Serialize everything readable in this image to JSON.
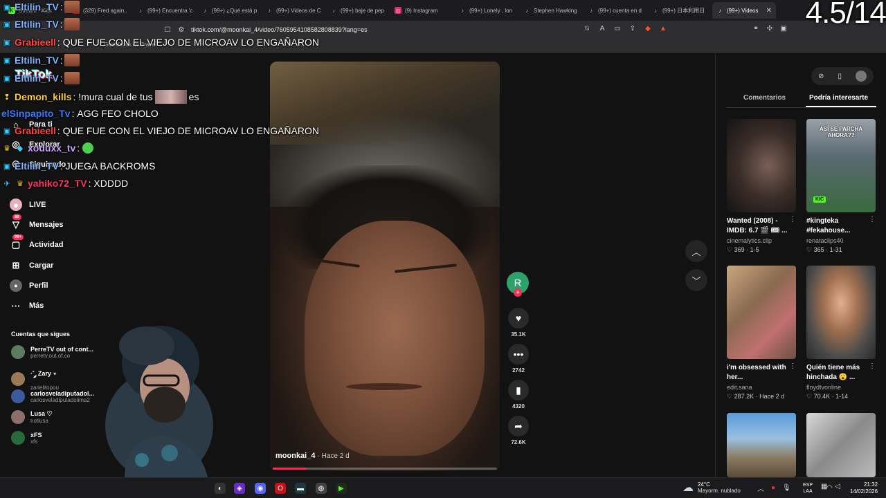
{
  "browser": {
    "tabs": [
      {
        "label": "Stream - Kick",
        "icon": "kick-icon",
        "color": "#53fc18"
      },
      {
        "label": "(329) Fred again..",
        "icon": "youtube-icon",
        "color": "#ff0000"
      },
      {
        "label": "(99+) Encuentra 'c",
        "icon": "tiktok-icon",
        "color": "#ffffff"
      },
      {
        "label": "(99+) ¿Qué está p",
        "icon": "tiktok-icon",
        "color": "#ffffff"
      },
      {
        "label": "(99+) Videos de C",
        "icon": "tiktok-icon",
        "color": "#ffffff"
      },
      {
        "label": "(99+) baje de pep",
        "icon": "tiktok-icon",
        "color": "#ffffff"
      },
      {
        "label": "(9) Instagram",
        "icon": "instagram-icon",
        "color": "#e1306c"
      },
      {
        "label": "(99+) Lonely , lon",
        "icon": "tiktok-icon",
        "color": "#ffffff"
      },
      {
        "label": "Stephen Hawking",
        "icon": "tiktok-icon",
        "color": "#ffffff"
      },
      {
        "label": "(99+) cuenta en d",
        "icon": "tiktok-icon",
        "color": "#ffffff"
      },
      {
        "label": "(99+) 日本利用日",
        "icon": "tiktok-icon",
        "color": "#ffffff"
      },
      {
        "label": "(99+) Videos",
        "icon": "tiktok-icon",
        "color": "#ffffff",
        "active": true
      }
    ],
    "url": "tiktok.com/@moonkai_4/video/7605954108582808839?lang=es",
    "bookmark_label": "Guardados de Brave"
  },
  "overlay": {
    "counter": "4.5/14"
  },
  "chat": [
    {
      "user": "Eltilin_TV",
      "color": "#7fb3ff",
      "sep": ":",
      "text": "",
      "emote": true
    },
    {
      "user": "Eltilin_TV",
      "color": "#7fb3ff",
      "sep": ":",
      "text": "",
      "emote": true
    },
    {
      "user": "Grabieell",
      "color": "#ff4444",
      "sep": ":",
      "text": "QUE FUE CON EL VIEJO DE MICROAV LO ENGAÑARON"
    },
    {
      "user": "Eltilin_TV",
      "color": "#7fb3ff",
      "sep": ":",
      "text": "",
      "emote": true
    },
    {
      "user": "Eltilin_TV",
      "color": "#7fb3ff",
      "sep": ":",
      "text": "",
      "emote": true
    },
    {
      "user": "Demon_kills",
      "color": "#ffcc33",
      "sep": ":",
      "text": "!mura cual de tus",
      "text2": "es"
    },
    {
      "user": "elSinpapito_Tv",
      "color": "#3a7bff",
      "sep": ":",
      "text": "AGG FEO CHOLO"
    },
    {
      "user": "Grabieell",
      "color": "#ff4444",
      "sep": ":",
      "text": "QUE FUE CON EL VIEJO DE MICROAV LO ENGAÑARON"
    },
    {
      "user": "xoduxx_tv",
      "color": "#c9a3ff",
      "sep": ":",
      "text": ""
    },
    {
      "user": "Eltilin_TV",
      "color": "#7fb3ff",
      "sep": ":",
      "text": "JUEGA BACKROMS"
    },
    {
      "user": "yahiko72_TV",
      "color": "#ff3366",
      "sep": ":",
      "text": "XDDDD"
    }
  ],
  "tiktok": {
    "logo": "TikTok",
    "nav": [
      {
        "label": "Para ti",
        "icon": "home-icon"
      },
      {
        "label": "Explorar",
        "icon": "compass-icon"
      },
      {
        "label": "Siguiendo",
        "icon": "following-icon"
      },
      {
        "label": "LIVE",
        "icon": "live-icon"
      },
      {
        "label": "Mensajes",
        "icon": "messages-icon",
        "badge": "88"
      },
      {
        "label": "Actividad",
        "icon": "activity-icon",
        "badge": "99+"
      },
      {
        "label": "Cargar",
        "icon": "upload-icon"
      },
      {
        "label": "Perfil",
        "icon": "profile-icon"
      },
      {
        "label": "Más",
        "icon": "more-icon"
      }
    ],
    "following_title": "Cuentas que sigues",
    "following": [
      {
        "name": "PerreTV out of cont...",
        "handle": "perretv.out.of.co"
      },
      {
        "name": "·˚ ༘ Zary ⋆",
        "handle": "zarielitopou"
      },
      {
        "name": "carlosveladiputadol...",
        "handle": "carlosveladiputadolima2"
      },
      {
        "name": "Lusa ♡",
        "handle": "notlusa"
      },
      {
        "name": "xFS",
        "handle": "xfs"
      }
    ],
    "video": {
      "author": "moonkai_4",
      "time": "· Hace 2 d",
      "progress": 0.15
    },
    "actions": {
      "avatar_letter": "R",
      "likes": "35.1K",
      "comments": "2742",
      "saves": "4320",
      "shares": "72.6K"
    },
    "panel": {
      "tab_comments": "Comentarios",
      "tab_suggested": "Podría interesarte",
      "cards": [
        {
          "title": "Wanted (2008) - IMDB: 6.7 🎬 🎟 ...",
          "user": "cinemalytics.clip",
          "likes": "369",
          "extra": "1-5"
        },
        {
          "title": "#kingteka #fekahouse...",
          "user": "renataclips40",
          "likes": "365",
          "extra": "1-31",
          "overlay": "ASÍ SE PARCHA AHORA??"
        },
        {
          "title": "i'm obsessed with her...",
          "user": "edit.sana",
          "likes": "287.2K",
          "extra": "Hace 2 d"
        },
        {
          "title": "Quién tiene más hinchada 😮 ...",
          "user": "floydtvonline",
          "likes": "70.4K",
          "extra": "1-14"
        }
      ]
    }
  },
  "taskbar": {
    "weather_temp": "24°C",
    "weather_desc": "Mayorm. nublado",
    "lang_top": "ESP",
    "lang_bottom": "LAA",
    "time": "21:32",
    "date": "14/02/2026"
  }
}
